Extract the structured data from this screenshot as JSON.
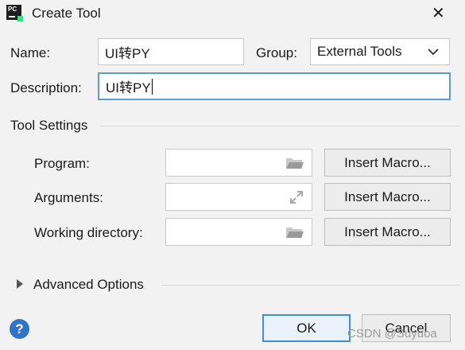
{
  "window": {
    "app_icon_text": "PC",
    "title": "Create Tool",
    "close_glyph": "✕"
  },
  "form": {
    "name_label": "Name:",
    "name_value": "UI转PY",
    "group_label": "Group:",
    "group_value": "External Tools",
    "description_label": "Description:",
    "description_value": "UI转PY"
  },
  "tool_settings": {
    "title": "Tool Settings",
    "program_label": "Program:",
    "program_value": "",
    "arguments_label": "Arguments:",
    "arguments_value": "",
    "working_dir_label": "Working directory:",
    "working_dir_value": "",
    "insert_macro_label": "Insert Macro..."
  },
  "advanced": {
    "title": "Advanced Options"
  },
  "footer": {
    "help_glyph": "?",
    "ok_label": "OK",
    "cancel_label": "Cancel"
  },
  "watermark": "CSDN @Suyuoa",
  "colors": {
    "focus_border": "#5a9ad9",
    "help_icon": "#2f74c9",
    "primary_border": "#3d8fd6"
  }
}
